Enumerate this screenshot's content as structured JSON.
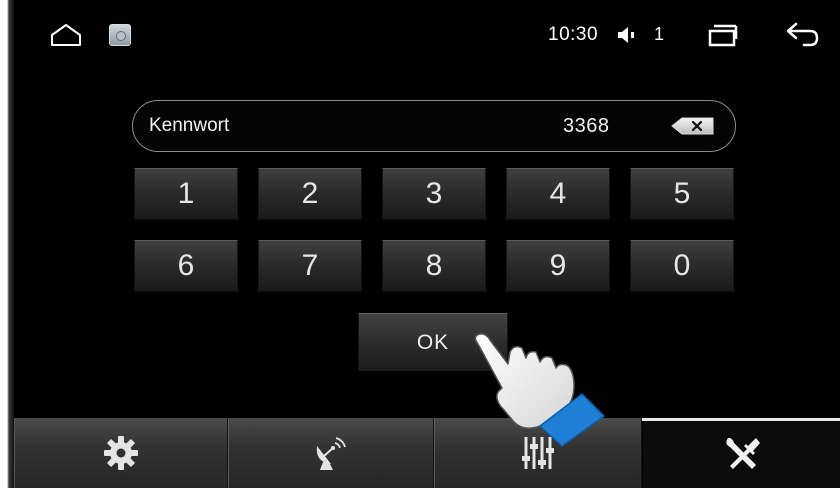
{
  "status_bar": {
    "home_icon": "home-icon",
    "app_icon": "settings-app-icon",
    "time": "10:30",
    "volume_icon": "speaker-icon",
    "volume_level": "1",
    "recents_icon": "recent-apps-icon",
    "back_icon": "back-arrow-icon"
  },
  "password_field": {
    "label": "Kennwort",
    "value": "3368",
    "backspace_icon": "backspace-icon"
  },
  "keypad": {
    "keys": [
      "1",
      "2",
      "3",
      "4",
      "5",
      "6",
      "7",
      "8",
      "9",
      "0"
    ],
    "ok_label": "OK"
  },
  "tab_bar": {
    "tabs": [
      {
        "icon": "gear-icon",
        "active": false
      },
      {
        "icon": "satellite-dish-icon",
        "active": false
      },
      {
        "icon": "equalizer-icon",
        "active": false
      },
      {
        "icon": "tools-icon",
        "active": true
      }
    ]
  },
  "colors": {
    "screen_bg": "#000000",
    "key_text": "#e6e6e6",
    "tab_bar_bg": "#333333",
    "active_indicator": "#e9e9e9",
    "cursor_accent": "#1e7fd6"
  }
}
